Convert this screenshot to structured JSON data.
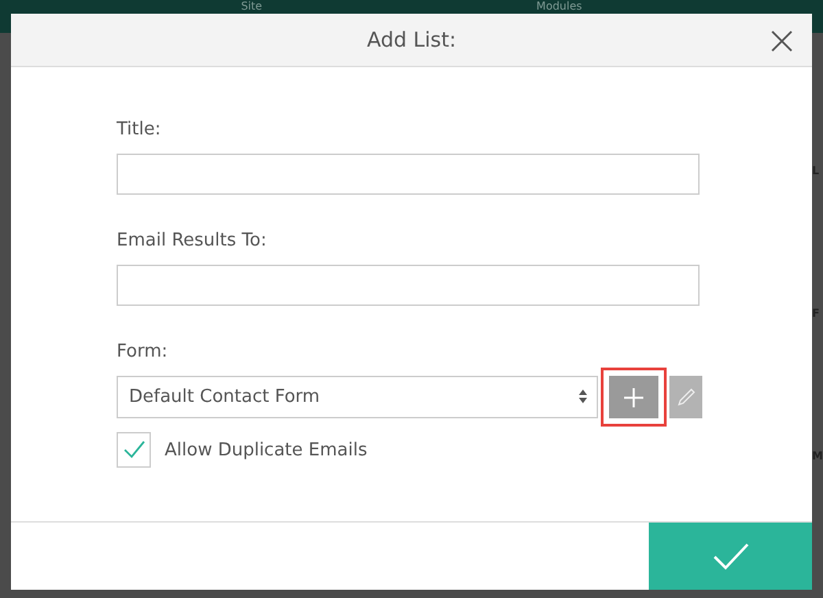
{
  "background": {
    "nav": [
      "Site",
      "Modules"
    ],
    "edge_letters": [
      "L",
      "F",
      "M"
    ]
  },
  "dialog": {
    "title": "Add List:",
    "fields": [
      {
        "label": "Title:"
      },
      {
        "label": "Email Results To:"
      }
    ],
    "form": {
      "label": "Form:",
      "value": "Default Contact Form",
      "add_highlighted": true
    },
    "allow_duplicates": {
      "label": "Allow Duplicate Emails",
      "checked": true
    }
  }
}
